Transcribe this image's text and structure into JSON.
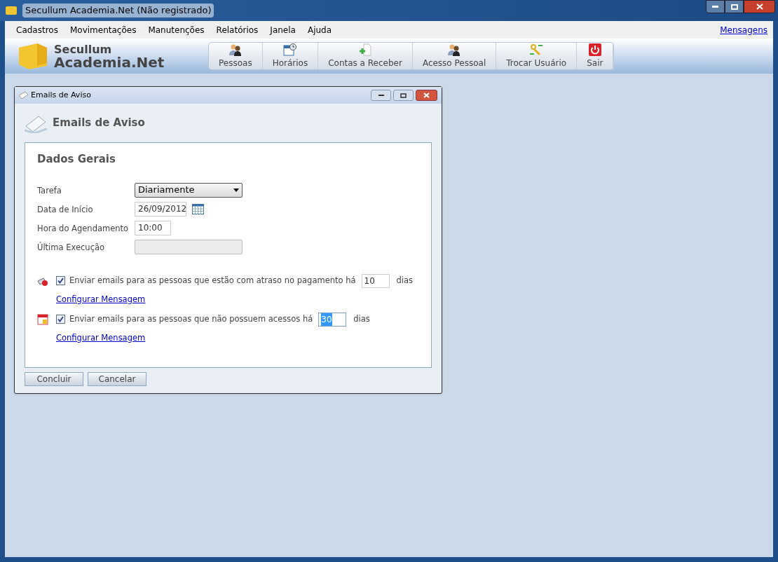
{
  "window": {
    "title": "Secullum Academia.Net (Não registrado)"
  },
  "menu": {
    "items": [
      "Cadastros",
      "Movimentações",
      "Manutenções",
      "Relatórios",
      "Janela",
      "Ajuda"
    ],
    "link": "Mensagens"
  },
  "logo": {
    "line_1": "Secullum",
    "line_2": "Academia.Net"
  },
  "toolbar": [
    {
      "label": "Pessoas",
      "kind": "people"
    },
    {
      "label": "Horários",
      "kind": "schedule"
    },
    {
      "label": "Contas a Receber",
      "kind": "add"
    },
    {
      "label": "Acesso Pessoal",
      "kind": "people"
    },
    {
      "label": "Trocar Usuário",
      "kind": "keys"
    },
    {
      "label": "Sair",
      "kind": "power"
    }
  ],
  "dialog": {
    "title": "Emails de Aviso",
    "heading": "Emails de Aviso",
    "section": "Dados Gerais",
    "fields": [
      {
        "label": "Tarefa",
        "kind": "dropdown",
        "value": "Diariamente"
      },
      {
        "label": "Data de Início",
        "kind": "date",
        "value": "26/09/2012"
      },
      {
        "label": "Hora do Agendamento",
        "kind": "time",
        "value": "10:00"
      },
      {
        "label": "Última Execução",
        "kind": "readonly"
      }
    ],
    "options": [
      {
        "kind": "payment",
        "checked": true,
        "text": "Enviar emails para as pessoas que estão com atraso no pagamento há",
        "days": "10",
        "highlighted": false,
        "unit": "dias",
        "link": "Configurar Mensagem"
      },
      {
        "kind": "access",
        "checked": true,
        "text": "Enviar emails para as pessoas que não possuem acessos há",
        "days": "30",
        "highlighted": true,
        "unit": "dias",
        "link": "Configurar Mensagem"
      }
    ],
    "buttons": [
      "Concluir",
      "Cancelar"
    ]
  }
}
